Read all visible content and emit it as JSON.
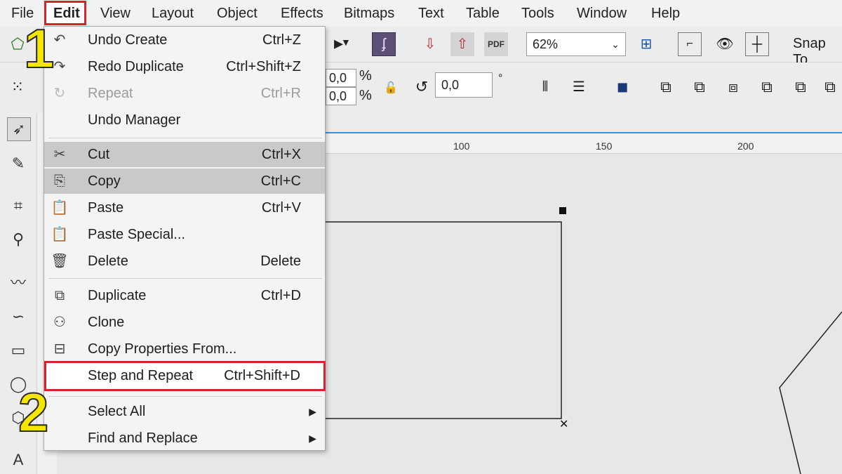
{
  "menubar": [
    "File",
    "Edit",
    "View",
    "Layout",
    "Object",
    "Effects",
    "Bitmaps",
    "Text",
    "Table",
    "Tools",
    "Window",
    "Help"
  ],
  "toolbar": {
    "zoom_value": "62%",
    "snap_label": "Snap To",
    "rotation_value": "0,0",
    "rotation_unit": "°",
    "scale_x": "0,0",
    "scale_y": "0,0",
    "percent": "%"
  },
  "ruler": {
    "ticks": [
      "100",
      "150",
      "200"
    ]
  },
  "edit_menu": {
    "items": [
      {
        "label": "Undo Create",
        "shortcut": "Ctrl+Z",
        "icon": "undo-icon"
      },
      {
        "label": "Redo Duplicate",
        "shortcut": "Ctrl+Shift+Z",
        "icon": "redo-icon"
      },
      {
        "label": "Repeat",
        "shortcut": "Ctrl+R",
        "icon": "repeat-icon",
        "disabled": true
      },
      {
        "label": "Undo Manager",
        "shortcut": "",
        "icon": ""
      },
      {
        "label": "Cut",
        "shortcut": "Ctrl+X",
        "icon": "scissors-icon",
        "highlight": true
      },
      {
        "label": "Copy",
        "shortcut": "Ctrl+C",
        "icon": "copy-icon",
        "highlight": true
      },
      {
        "label": "Paste",
        "shortcut": "Ctrl+V",
        "icon": "paste-icon"
      },
      {
        "label": "Paste Special...",
        "shortcut": "",
        "icon": "paste-special-icon"
      },
      {
        "label": "Delete",
        "shortcut": "Delete",
        "icon": "trash-icon"
      },
      {
        "label": "Duplicate",
        "shortcut": "Ctrl+D",
        "icon": "duplicate-icon"
      },
      {
        "label": "Clone",
        "shortcut": "",
        "icon": "clone-icon"
      },
      {
        "label": "Copy Properties From...",
        "shortcut": "",
        "icon": "copy-properties-icon"
      },
      {
        "label": "Step and Repeat",
        "shortcut": "Ctrl+Shift+D",
        "icon": ""
      },
      {
        "label": "Select All",
        "shortcut": "",
        "icon": "",
        "submenu": true
      },
      {
        "label": "Find and Replace",
        "shortcut": "",
        "icon": "",
        "submenu": true
      }
    ]
  },
  "callouts": {
    "step1": "1",
    "step2": "2"
  },
  "colors": {
    "highlight_red": "#d9232b",
    "callout_yellow": "#f5e600"
  }
}
